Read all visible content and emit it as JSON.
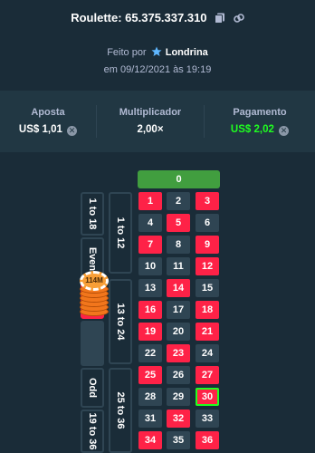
{
  "header": {
    "title": "Roulette: 65.375.337.310",
    "byline_prefix": "Feito por",
    "user": "Londrina",
    "date": "em 09/12/2021 às 19:19"
  },
  "stats": {
    "bet_label": "Aposta",
    "bet_value": "US$ 1,01",
    "multiplier_label": "Multiplicador",
    "multiplier_value": "2,00×",
    "payout_label": "Pagamento",
    "payout_value": "US$ 2,02"
  },
  "colors": {
    "bg": "#1a2c38",
    "panel": "#213743",
    "red": "#fe2247",
    "black": "#2f4553",
    "green": "#419e3f",
    "win": "#1fff20"
  },
  "board": {
    "zero": "0",
    "dozens": [
      "1 to 12",
      "13 to 24",
      "25 to 36"
    ],
    "outside": [
      "1 to 18",
      "Even",
      "",
      "",
      "Odd",
      "19 to 36"
    ],
    "chip_label": "114M",
    "winning_number": "30",
    "rows": [
      [
        {
          "n": "1",
          "c": "red"
        },
        {
          "n": "2",
          "c": "black"
        },
        {
          "n": "3",
          "c": "red"
        }
      ],
      [
        {
          "n": "4",
          "c": "black"
        },
        {
          "n": "5",
          "c": "red"
        },
        {
          "n": "6",
          "c": "black"
        }
      ],
      [
        {
          "n": "7",
          "c": "red"
        },
        {
          "n": "8",
          "c": "black"
        },
        {
          "n": "9",
          "c": "red"
        }
      ],
      [
        {
          "n": "10",
          "c": "black"
        },
        {
          "n": "11",
          "c": "black"
        },
        {
          "n": "12",
          "c": "red"
        }
      ],
      [
        {
          "n": "13",
          "c": "black"
        },
        {
          "n": "14",
          "c": "red"
        },
        {
          "n": "15",
          "c": "black"
        }
      ],
      [
        {
          "n": "16",
          "c": "red"
        },
        {
          "n": "17",
          "c": "black"
        },
        {
          "n": "18",
          "c": "red"
        }
      ],
      [
        {
          "n": "19",
          "c": "red"
        },
        {
          "n": "20",
          "c": "black"
        },
        {
          "n": "21",
          "c": "red"
        }
      ],
      [
        {
          "n": "22",
          "c": "black"
        },
        {
          "n": "23",
          "c": "red"
        },
        {
          "n": "24",
          "c": "black"
        }
      ],
      [
        {
          "n": "25",
          "c": "red"
        },
        {
          "n": "26",
          "c": "black"
        },
        {
          "n": "27",
          "c": "red"
        }
      ],
      [
        {
          "n": "28",
          "c": "black"
        },
        {
          "n": "29",
          "c": "black"
        },
        {
          "n": "30",
          "c": "red"
        }
      ],
      [
        {
          "n": "31",
          "c": "black"
        },
        {
          "n": "32",
          "c": "red"
        },
        {
          "n": "33",
          "c": "black"
        }
      ],
      [
        {
          "n": "34",
          "c": "red"
        },
        {
          "n": "35",
          "c": "black"
        },
        {
          "n": "36",
          "c": "red"
        }
      ]
    ]
  }
}
